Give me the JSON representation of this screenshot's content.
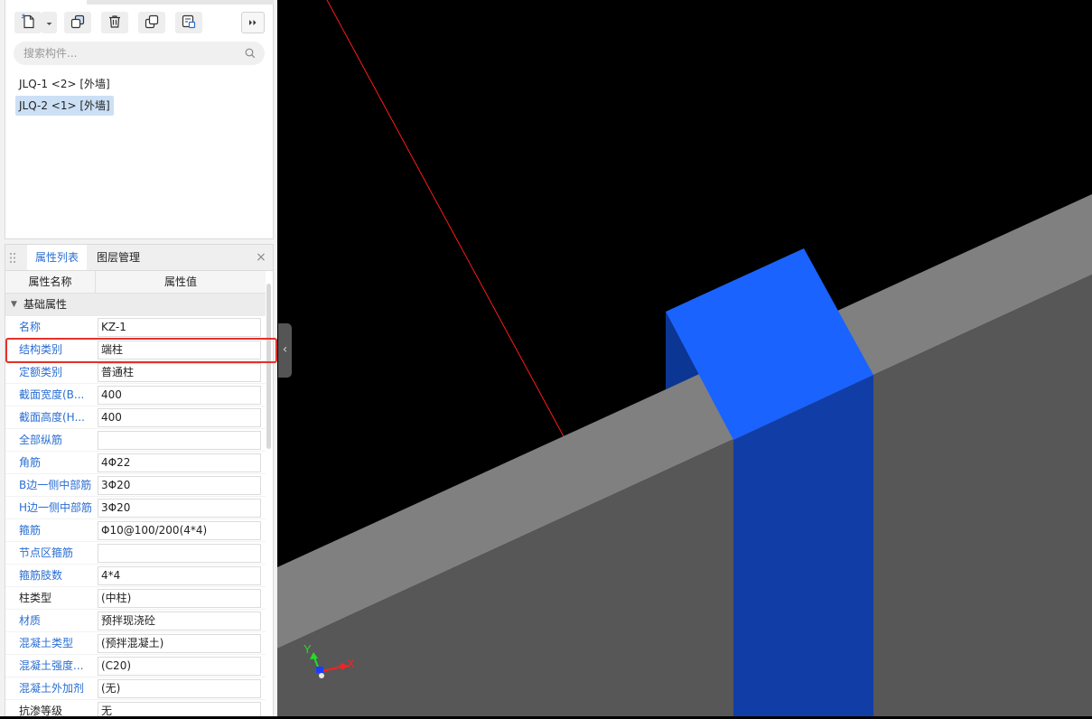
{
  "toolbar": {
    "buttons": [
      {
        "icon": "new-component-icon"
      },
      {
        "icon": "dropdown-arrow-icon"
      },
      {
        "icon": "copy-icon"
      },
      {
        "icon": "delete-icon"
      },
      {
        "icon": "layer-copy-icon"
      },
      {
        "icon": "copy-from-floor-icon"
      },
      {
        "icon": "expand-right-icon"
      }
    ]
  },
  "search": {
    "placeholder": "搜索构件...",
    "icon": "search-icon"
  },
  "component_list": [
    {
      "label": "JLQ-1 <2> [外墙]",
      "selected": false
    },
    {
      "label": "JLQ-2 <1> [外墙]",
      "selected": true
    }
  ],
  "properties": {
    "tabs": [
      {
        "label": "属性列表",
        "active": true
      },
      {
        "label": "图层管理",
        "active": false
      }
    ],
    "close_icon": "close-icon",
    "columns": [
      "属性名称",
      "属性值"
    ],
    "group": "基础属性",
    "rows": [
      {
        "label": "名称",
        "value": "KZ-1",
        "public": true
      },
      {
        "label": "结构类别",
        "value": "端柱",
        "public": true,
        "highlighted": true
      },
      {
        "label": "定额类别",
        "value": "普通柱",
        "public": true
      },
      {
        "label": "截面宽度(B...",
        "value": "400",
        "public": true
      },
      {
        "label": "截面高度(H...",
        "value": "400",
        "public": true
      },
      {
        "label": "全部纵筋",
        "value": "",
        "public": true
      },
      {
        "label": "角筋",
        "value": "4Φ22",
        "public": true
      },
      {
        "label": "B边一侧中部筋",
        "value": "3Φ20",
        "public": true
      },
      {
        "label": "H边一侧中部筋",
        "value": "3Φ20",
        "public": true
      },
      {
        "label": "箍筋",
        "value": "Φ10@100/200(4*4)",
        "public": true
      },
      {
        "label": "节点区箍筋",
        "value": "",
        "public": true
      },
      {
        "label": "箍筋肢数",
        "value": "4*4",
        "public": true
      },
      {
        "label": "柱类型",
        "value": "(中柱)",
        "public": false
      },
      {
        "label": "材质",
        "value": "预拌现浇砼",
        "public": true
      },
      {
        "label": "混凝土类型",
        "value": "(预拌混凝土)",
        "public": true
      },
      {
        "label": "混凝土强度...",
        "value": "(C20)",
        "public": true
      },
      {
        "label": "混凝土外加剂",
        "value": "(无)",
        "public": true
      },
      {
        "label": "抗渗等级",
        "value": "无",
        "public": false
      }
    ]
  },
  "viewport": {
    "axis": {
      "x": "X",
      "y": "Y"
    },
    "collapse_icon": "chevron-left-icon"
  },
  "colors": {
    "public_label": "#2a6ed2",
    "private_label": "#222222",
    "highlight": "#e5312b",
    "column_top": "#1a63ff",
    "column_side": "#113ea6",
    "wall_top": "#808080",
    "wall_side": "#575757",
    "axis_x": "#ff2020",
    "axis_y": "#22dd22"
  }
}
